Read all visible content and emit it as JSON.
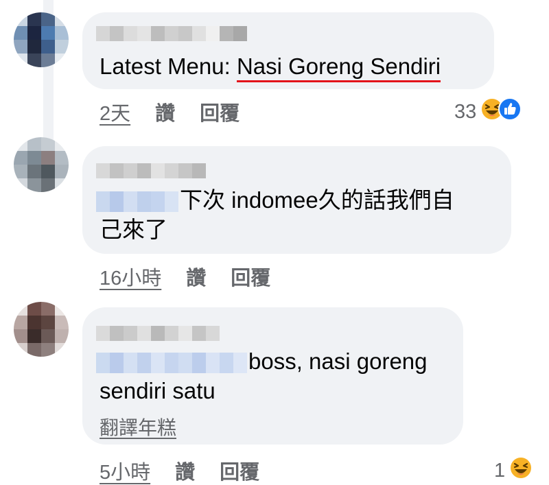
{
  "comments": [
    {
      "text_before": "Latest Menu: ",
      "text_highlight": "Nasi Goreng Sendiri",
      "time": "2天",
      "like_label": "讚",
      "reply_label": "回覆",
      "reaction_count": "33",
      "reactions": [
        "haha-icon",
        "like-icon"
      ]
    },
    {
      "text_line1": "下次 indomee久的話我們自",
      "text_line2": "己來了",
      "time": "16小時",
      "like_label": "讚",
      "reply_label": "回覆"
    },
    {
      "text_line1": "boss, nasi goreng",
      "text_line2": "sendiri satu",
      "translate": "翻譯年糕",
      "time": "5小時",
      "like_label": "讚",
      "reply_label": "回覆",
      "reaction_count": "1",
      "reactions": [
        "haha-icon"
      ]
    }
  ],
  "colors": {
    "bubble": "#f0f2f5",
    "meta_text": "#65676b",
    "highlight_underline": "#e3131b",
    "like_blue": "#1877f2",
    "haha_yellow": "#f7b125"
  }
}
